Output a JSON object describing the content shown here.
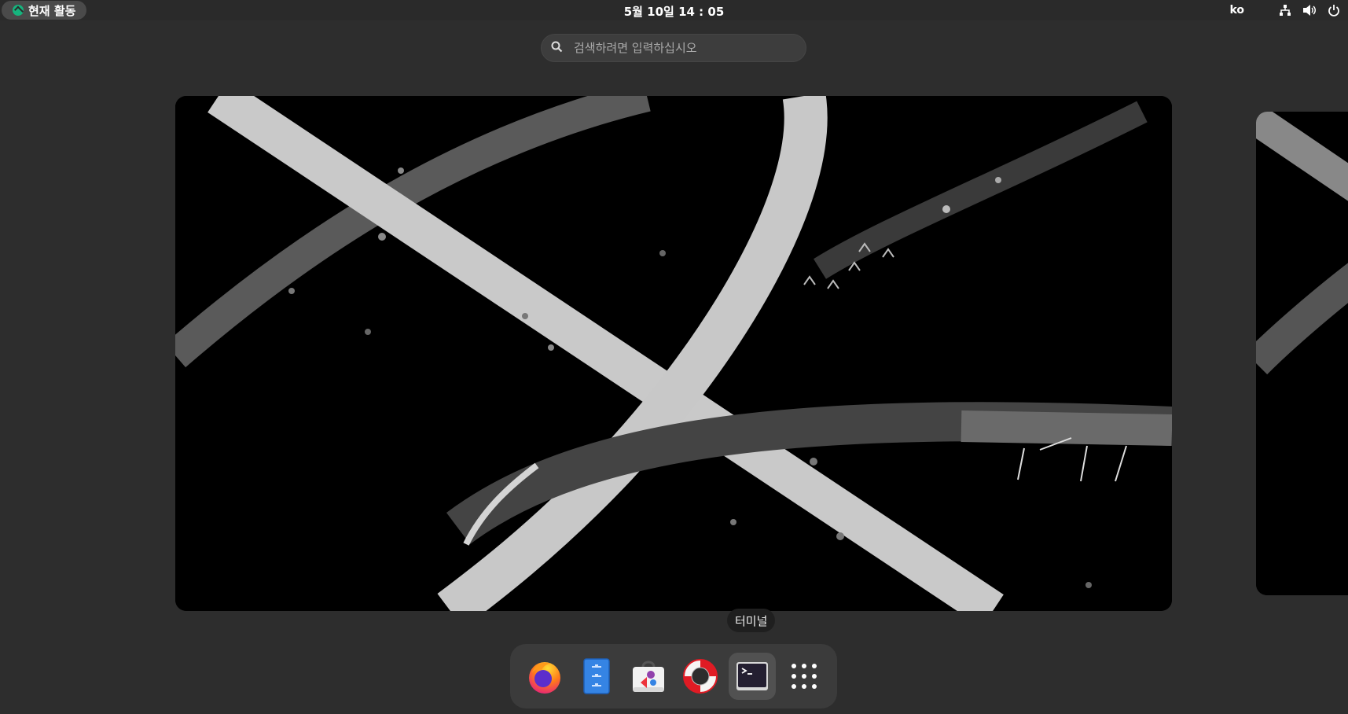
{
  "topbar": {
    "activities_label": "현재 활동",
    "clock": "5월 10일  14 : 05",
    "language": "ko"
  },
  "search": {
    "placeholder": "검색하려면 입력하십시오"
  },
  "dock": {
    "tooltip": "터미널",
    "apps": [
      {
        "name": "Firefox",
        "icon": "firefox-icon"
      },
      {
        "name": "파일",
        "icon": "files-icon"
      },
      {
        "name": "소프트웨어",
        "icon": "software-icon"
      },
      {
        "name": "도움말",
        "icon": "help-icon"
      },
      {
        "name": "터미널",
        "icon": "terminal-icon",
        "active": true
      },
      {
        "name": "프로그램 보기",
        "icon": "app-grid-icon"
      }
    ]
  },
  "colors": {
    "accent": "#16b37d",
    "background": "#2d2d2d",
    "dock": "#3b3b3b"
  }
}
